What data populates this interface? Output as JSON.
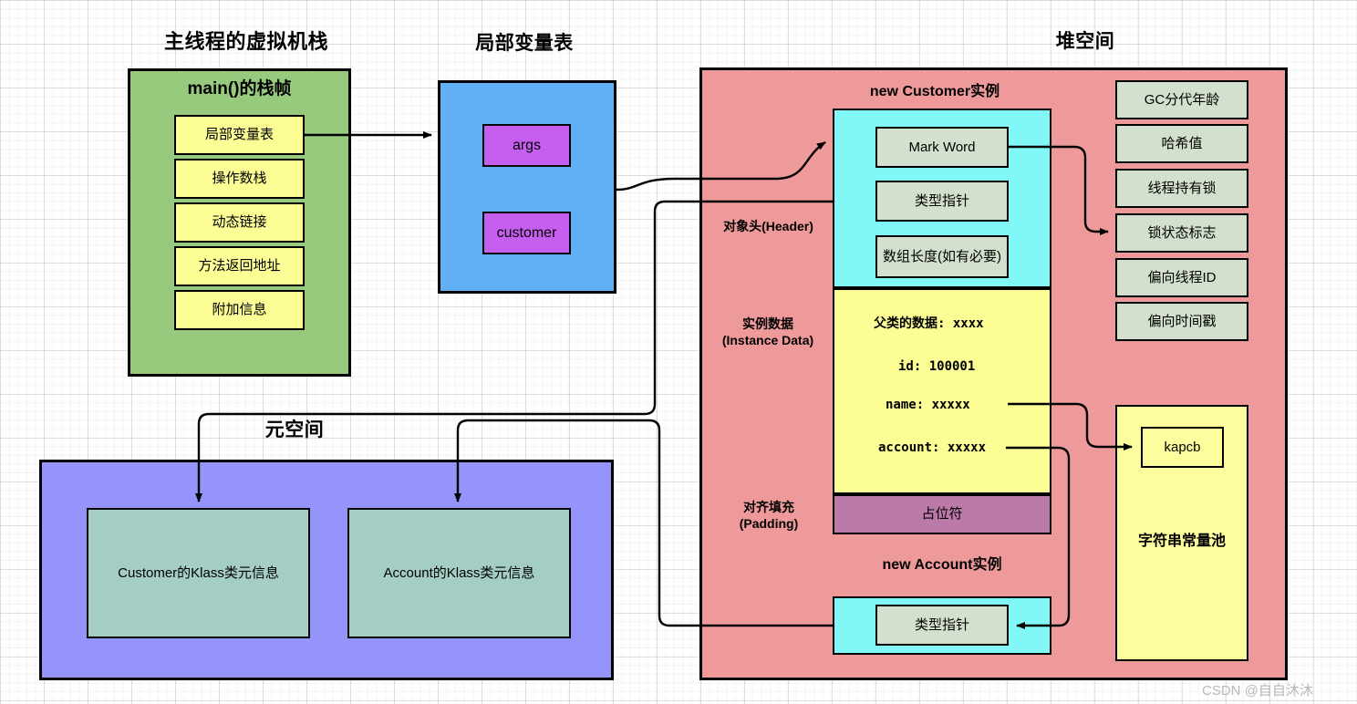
{
  "watermark": "CSDN @自自沐沐",
  "titles": {
    "stack": "主线程的虚拟机栈",
    "localvars": "局部变量表",
    "heap": "堆空间",
    "metaspace": "元空间"
  },
  "stack": {
    "frame_title": "main()的栈帧",
    "slots": [
      "局部变量表",
      "操作数栈",
      "动态链接",
      "方法返回地址",
      "附加信息"
    ]
  },
  "local_variable_table": {
    "entries": [
      "args",
      "customer"
    ]
  },
  "heap": {
    "customer_instance_title": "new Customer实例",
    "account_instance_title": "new Account实例",
    "side_labels": {
      "header": "对象头(Header)",
      "instance_data": "实例数据\n(Instance Data)",
      "padding": "对齐填充\n(Padding)"
    },
    "customer_header_rows": [
      "Mark Word",
      "类型指针",
      "数组长度(如有必要)"
    ],
    "customer_fields": [
      "父类的数据: xxxx",
      "id: 100001",
      "name: xxxxx",
      "account: xxxxx"
    ],
    "padding_label": "占位符",
    "account_header_rows": [
      "类型指针"
    ],
    "mark_word_detail": [
      "GC分代年龄",
      "哈希值",
      "线程持有锁",
      "锁状态标志",
      "偏向线程ID",
      "偏向时间戳"
    ],
    "string_pool": {
      "title": "字符串常量池",
      "entries": [
        "kapcb"
      ]
    }
  },
  "metaspace": {
    "klasses": [
      "Customer的Klass类元信息",
      "Account的Klass类元信息"
    ]
  },
  "colors": {
    "stack_region": "#97ca7c",
    "slot": "#fdfd96",
    "localvars_region": "#61aff5",
    "localvars_entry": "#c65ef0",
    "heap_region": "#ef9a9a",
    "object_header": "#81f7f7",
    "header_row": "#d2e0cd",
    "instance_data": "#fdfd96",
    "padding": "#bc7aa8",
    "metaspace_region": "#9494fb",
    "klass_box": "#a4cdc3",
    "string_pool": "#fdfd9e",
    "stroke": "#000000"
  }
}
